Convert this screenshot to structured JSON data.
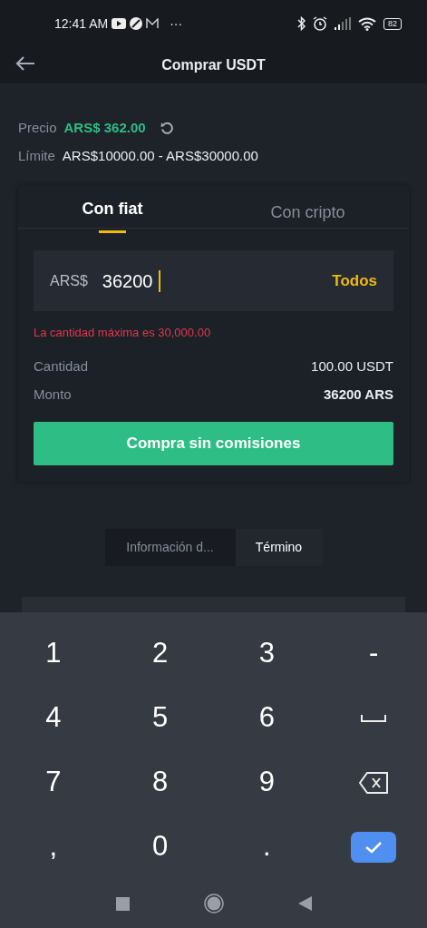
{
  "status_bar": {
    "time": "12:41 AM",
    "more": "···",
    "battery": "82"
  },
  "header": {
    "title": "Comprar USDT"
  },
  "price": {
    "label": "Precio",
    "value": "ARS$ 362.00"
  },
  "limit": {
    "label": "Límite",
    "value": "ARS$10000.00 - ARS$30000.00"
  },
  "tabs": [
    {
      "label": "Con fiat",
      "selected": true
    },
    {
      "label": "Con cripto",
      "selected": false
    }
  ],
  "amount_field": {
    "prefix": "ARS$",
    "value": "36200",
    "action": "Todos"
  },
  "error": "La cantidad máxima es 30,000.00",
  "summary": [
    {
      "label": "Cantidad",
      "value": "100.00 USDT",
      "bold": false
    },
    {
      "label": "Monto",
      "value": "36200 ARS",
      "bold": true
    }
  ],
  "buy_button": "Compra sin comisiones",
  "segments": [
    {
      "label": "Información d...",
      "selected": false
    },
    {
      "label": "Término",
      "selected": true
    }
  ],
  "keyboard": {
    "keys": [
      {
        "kind": "text",
        "label": "1"
      },
      {
        "kind": "text",
        "label": "2"
      },
      {
        "kind": "text",
        "label": "3"
      },
      {
        "kind": "text",
        "label": "-"
      },
      {
        "kind": "text",
        "label": "4"
      },
      {
        "kind": "text",
        "label": "5"
      },
      {
        "kind": "text",
        "label": "6"
      },
      {
        "kind": "space"
      },
      {
        "kind": "text",
        "label": "7"
      },
      {
        "kind": "text",
        "label": "8"
      },
      {
        "kind": "text",
        "label": "9"
      },
      {
        "kind": "delete"
      },
      {
        "kind": "text",
        "label": ","
      },
      {
        "kind": "text",
        "label": "0"
      },
      {
        "kind": "text",
        "label": "."
      },
      {
        "kind": "done"
      }
    ]
  }
}
